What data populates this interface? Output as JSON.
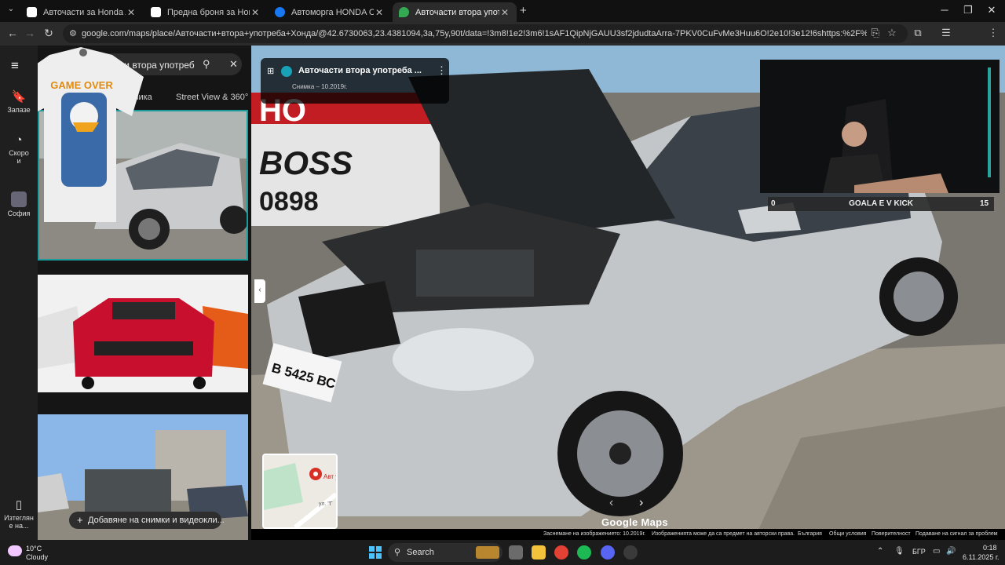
{
  "browser": {
    "tabs": [
      {
        "title": "Авточасти за Honda Accord VI",
        "active": false
      },
      {
        "title": "Предна броня за Honda Accord",
        "active": false
      },
      {
        "title": "Автоморга HONDA София/ Бу",
        "active": false
      },
      {
        "title": "Авточасти втора употреба Хо",
        "active": true
      }
    ],
    "new_tab": "+",
    "window_controls": {
      "minimize": "─",
      "maximize": "❐",
      "close": "✕"
    },
    "url": "google.com/maps/place/Авточасти+втора+употреба+Хонда/@42.6730063,23.4381094,3a,75y,90t/data=!3m8!1e2!3m6!1sAF1QipNjGAUU3sf2jdudtaArra-7PKV0CuFvMe3Huu6O!2e10!3e12!6shttps:%2F%2Flh3.googleusercontent.com%2Fp..."
  },
  "maps": {
    "rail": [
      {
        "label": "Запазе",
        "icon": "bookmark-icon"
      },
      {
        "label": "Скоро\nи",
        "icon": "history-icon"
      },
      {
        "label": "София",
        "icon": "place-icon"
      },
      {
        "label": "Изтеглян\nе на...",
        "icon": "phone-icon"
      }
    ],
    "search_query": "Авточасти втора употреб",
    "subtabs": [
      "ственика",
      "Street View & 360°"
    ],
    "add_photo_label": "Добавяне на снимки и видеокли...",
    "photo_card": {
      "name": "Авточасти втора употреба ...",
      "date": "Снимка – 10.2019г."
    },
    "minimap_label": "Авт\nупо",
    "minimap_street": "ул. \"Г",
    "brand": "Google Maps",
    "footer": [
      "Заснемане на изображението: 10.2019г.",
      "Изображенията може да са предмет на авторски права.",
      "България",
      "Общи условия",
      "Поверителност",
      "Подаване на сигнал за проблем"
    ],
    "car_plate": "В 5425 ВС",
    "banner_text": [
      "HO",
      "BOSS",
      "0898"
    ],
    "shirt_text": "GAME OVER"
  },
  "stream": {
    "score_left": "0",
    "score_title": "GOALA E V KICK",
    "score_right": "15"
  },
  "taskbar": {
    "weather_temp": "10°C",
    "weather_desc": "Cloudy",
    "search_label": "Search",
    "language": "БГР",
    "time": "0:18",
    "date": "6.11.2025 г."
  },
  "colors": {
    "accent_tab": "#2b2b2b",
    "maps_bg": "#151515",
    "pin": "#d93025"
  }
}
